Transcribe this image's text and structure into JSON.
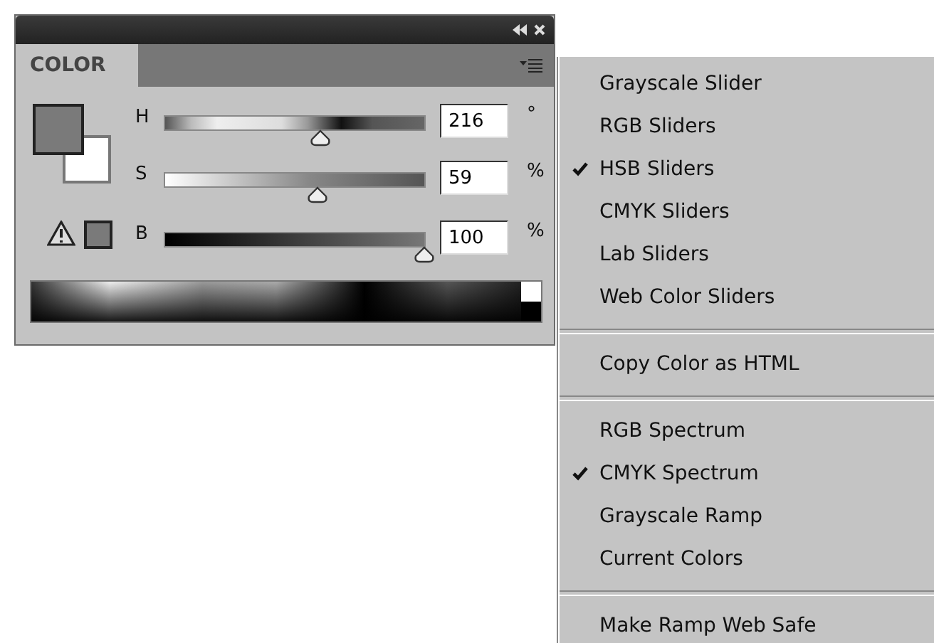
{
  "panel": {
    "tab": {
      "label": "COLOR",
      "selected": true
    },
    "sliders": [
      {
        "kind": "hue",
        "label": "H",
        "level": 0.6,
        "value": "216",
        "unit": "°"
      },
      {
        "kind": "saturation",
        "label": "S",
        "level": 0.59,
        "value": "59",
        "unit": "%"
      },
      {
        "kind": "brightness",
        "label": "B",
        "level": 1,
        "value": "100",
        "unit": "%"
      }
    ]
  },
  "menu": {
    "items": [
      {
        "kind": "item",
        "label": "Grayscale Slider",
        "checked": false
      },
      {
        "kind": "item",
        "label": "RGB Sliders",
        "checked": false
      },
      {
        "kind": "item",
        "label": "HSB Sliders",
        "checked": true
      },
      {
        "kind": "item",
        "label": "CMYK Sliders",
        "checked": false
      },
      {
        "kind": "item",
        "label": "Lab Sliders",
        "checked": false
      },
      {
        "kind": "item",
        "label": "Web Color Sliders",
        "checked": false
      },
      {
        "kind": "separator"
      },
      {
        "kind": "item",
        "label": "Copy Color as HTML",
        "checked": false
      },
      {
        "kind": "separator"
      },
      {
        "kind": "item",
        "label": "RGB Spectrum",
        "checked": false
      },
      {
        "kind": "item",
        "label": "CMYK Spectrum",
        "checked": true
      },
      {
        "kind": "item",
        "label": "Grayscale Ramp",
        "checked": false
      },
      {
        "kind": "item",
        "label": "Current Colors",
        "checked": false
      },
      {
        "kind": "separator"
      },
      {
        "kind": "item",
        "label": "Make Ramp Web Safe",
        "checked": false
      }
    ]
  }
}
